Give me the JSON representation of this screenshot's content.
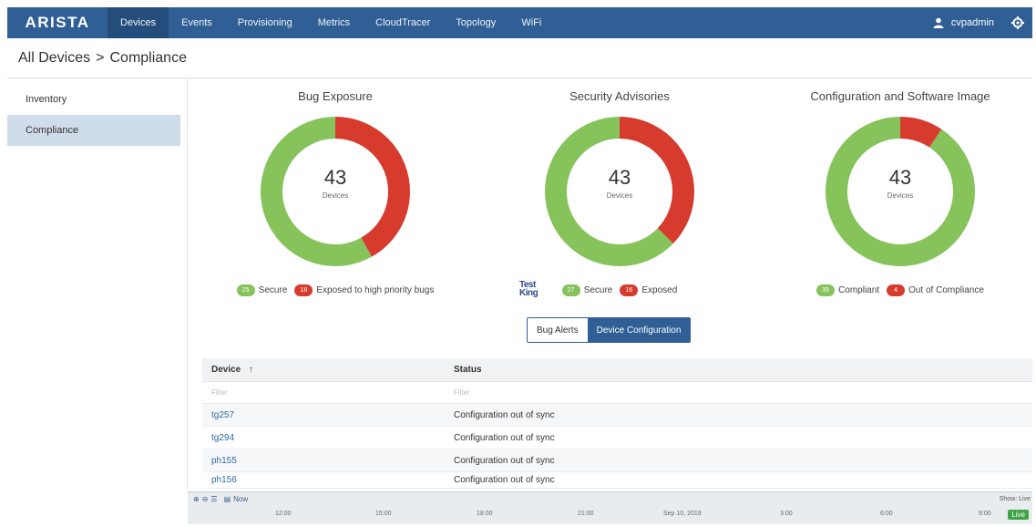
{
  "nav": {
    "logo": "ARISTA",
    "items": [
      {
        "label": "Devices",
        "active": true
      },
      {
        "label": "Events",
        "active": false
      },
      {
        "label": "Provisioning",
        "active": false
      },
      {
        "label": "Metrics",
        "active": false
      },
      {
        "label": "CloudTracer",
        "active": false
      },
      {
        "label": "Topology",
        "active": false
      },
      {
        "label": "WiFi",
        "active": false
      }
    ],
    "user": "cvpadmin",
    "icons": {
      "user": "user-icon",
      "settings": "gear-icon"
    }
  },
  "breadcrumb": {
    "root": "All Devices",
    "separator": ">",
    "current": "Compliance"
  },
  "sidebar": {
    "items": [
      {
        "label": "Inventory",
        "active": false
      },
      {
        "label": "Compliance",
        "active": true
      }
    ]
  },
  "colors": {
    "secure": "#86c35b",
    "exposed": "#d63b2e",
    "accent": "#2f5f95"
  },
  "summaries": [
    {
      "title": "Bug Exposure",
      "total": "43",
      "unit": "Devices",
      "good": {
        "count": "25",
        "label": "Secure",
        "value": 25
      },
      "bad": {
        "count": "18",
        "label": "Exposed to high priority bugs",
        "value": 18
      }
    },
    {
      "title": "Security Advisories",
      "total": "43",
      "unit": "Devices",
      "good": {
        "count": "27",
        "label": "Secure",
        "value": 27
      },
      "bad": {
        "count": "16",
        "label": "Exposed",
        "value": 16
      }
    },
    {
      "title": "Configuration and Software Image",
      "total": "43",
      "unit": "Devices",
      "good": {
        "count": "39",
        "label": "Compliant",
        "value": 39
      },
      "bad": {
        "count": "4",
        "label": "Out of Compliance",
        "value": 4
      }
    }
  ],
  "watermark": "Test\nKing",
  "view_toggle": {
    "options": [
      "Bug Alerts",
      "Device Configuration"
    ],
    "selected": "Device Configuration"
  },
  "table": {
    "columns": [
      "Device",
      "Status"
    ],
    "sort_icon": "arrow-up-icon",
    "filter_placeholder": "Filter",
    "rows": [
      {
        "device": "tg257",
        "status": "Configuration out of sync"
      },
      {
        "device": "tg294",
        "status": "Configuration out of sync"
      },
      {
        "device": "ph155",
        "status": "Configuration out of sync"
      },
      {
        "device": "ph156",
        "status": "Configuration out of sync"
      }
    ]
  },
  "timeline": {
    "now_label": "Now",
    "show_label": "Show: Live",
    "live_label": "Live",
    "ticks": [
      "12:00",
      "15:00",
      "18:00",
      "21:00",
      "Sep 10, 2019",
      "3:00",
      "6:00",
      "9:00"
    ]
  }
}
